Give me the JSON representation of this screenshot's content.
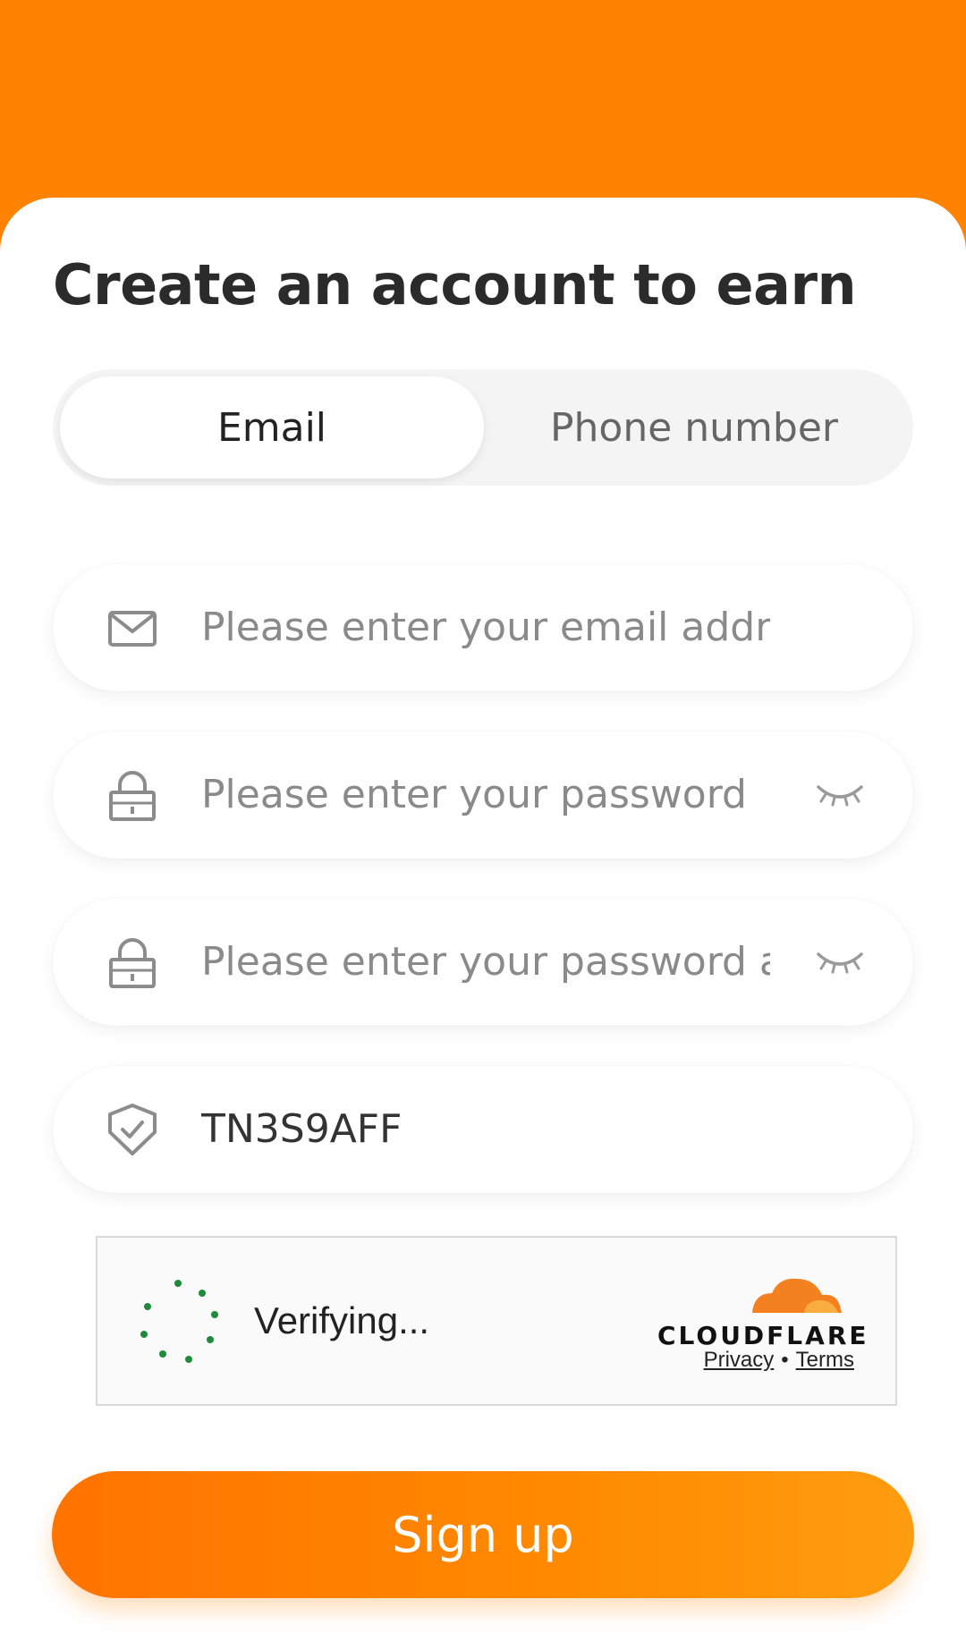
{
  "page": {
    "title": "Create an account to earn"
  },
  "tabs": [
    {
      "label": "Email",
      "active": true
    },
    {
      "label": "Phone number",
      "active": false
    }
  ],
  "fields": {
    "email": {
      "placeholder": "Please enter your email address",
      "value": "",
      "icon": "envelope-icon"
    },
    "password": {
      "placeholder": "Please enter your password",
      "value": "",
      "icon": "lock-icon"
    },
    "password_confirm": {
      "placeholder": "Please enter your password again",
      "value": "",
      "icon": "lock-icon"
    },
    "invite_code": {
      "placeholder": "",
      "value": "TN3S9AFF",
      "icon": "shield-check-icon"
    }
  },
  "captcha": {
    "status": "Verifying...",
    "brand": "CLOUDFLARE",
    "privacy_label": "Privacy",
    "terms_label": "Terms",
    "separator": "•"
  },
  "actions": {
    "signup_label": "Sign up"
  },
  "colors": {
    "brand": "#ff8200",
    "spinner": "#1e8a3a",
    "cloudflare": "#f48120"
  }
}
